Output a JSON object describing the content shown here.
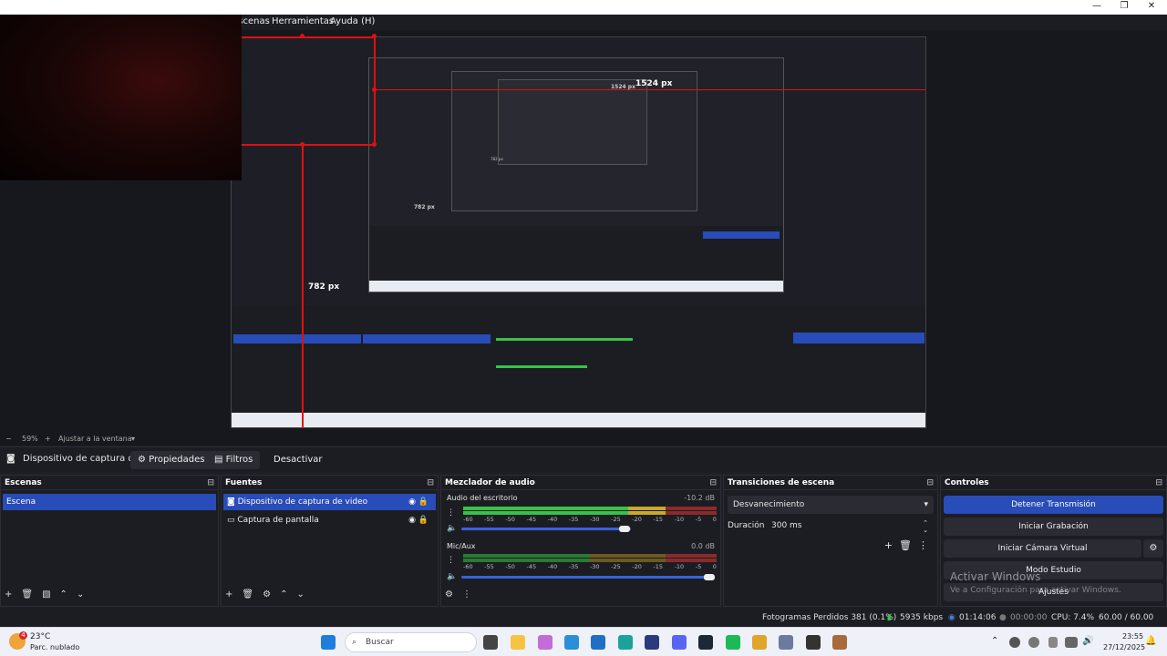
{
  "window": {
    "minimize": "—",
    "maximize": "❐",
    "close": "✕"
  },
  "menu": {
    "items": [
      "Escenas",
      "Herramientas",
      "Ayuda (H)"
    ]
  },
  "preview": {
    "measure_label_width": "1524 px",
    "measure_label_height": "782 px",
    "nested_width": "1524 px",
    "nested_height": "782 px",
    "nested_tiny": "782 px"
  },
  "zoom": {
    "minus": "−",
    "value": "59%",
    "plus": "+",
    "fit_label": "Ajustar a la ventana"
  },
  "source_toolbar": {
    "source_name": "Dispositivo de captura de v",
    "properties": "Propiedades",
    "filters": "Filtros",
    "deactivate": "Desactivar"
  },
  "scenes": {
    "title": "Escenas",
    "items": [
      "Escena"
    ]
  },
  "sources": {
    "title": "Fuentes",
    "items": [
      "Dispositivo de captura de video",
      "Captura de pantalla"
    ]
  },
  "mixer": {
    "title": "Mezclador de audio",
    "channels": [
      {
        "name": "Audio del escritorio",
        "db": "-10.2 dB",
        "level": 0.8,
        "volume": 0.6
      },
      {
        "name": "Mic/Aux",
        "db": "0.0 dB",
        "level": 0.5,
        "volume": 0.98
      }
    ],
    "ticks": [
      "-60",
      "-55",
      "-50",
      "-45",
      "-40",
      "-35",
      "-30",
      "-25",
      "-20",
      "-15",
      "-10",
      "-5",
      "0"
    ]
  },
  "transitions": {
    "title": "Transiciones de escena",
    "selected": "Desvanecimiento",
    "duration_label": "Duración",
    "duration_value": "300 ms"
  },
  "controls": {
    "title": "Controles",
    "stop_stream": "Detener Transmisión",
    "start_recording": "Iniciar Grabación",
    "start_virtual_cam": "Iniciar Cámara Virtual",
    "studio_mode": "Modo Estudio",
    "settings": "Ajustes",
    "watermark_title": "Activar Windows",
    "watermark_sub": "Ve a Configuración para activar Windows."
  },
  "status": {
    "dropped_frames": "Fotogramas Perdidos 381 (0.1%)",
    "bitrate": "5935 kbps",
    "stream_time": "01:14:06",
    "rec_time": "00:00:00",
    "cpu": "CPU: 7.4%",
    "fps": "60.00 / 60.00 FPS"
  },
  "taskbar": {
    "weather_temp": "23°C",
    "weather_desc": "Parc. nublado",
    "weather_badge": "4",
    "search_placeholder": "Buscar",
    "time": "23:55",
    "date": "27/12/2025"
  },
  "colors": {
    "accent": "#284cb8",
    "measure": "#e01010",
    "meter_green": "#37c24a",
    "meter_yellow": "#c9a82b"
  }
}
